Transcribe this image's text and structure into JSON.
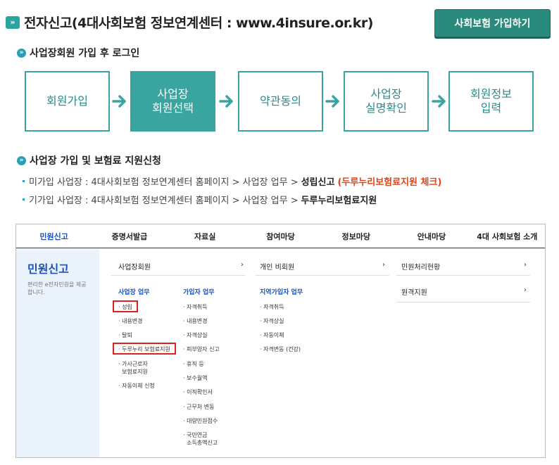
{
  "header": {
    "title_icon": "»",
    "title": "전자신고(4대사회보험 정보연계센터 : www.4insure.or.kr)",
    "join_button": "사회보험 가입하기"
  },
  "section1": {
    "icon": "»",
    "title": "사업장회원 가입 후 로그인",
    "steps": [
      "회원가입",
      "사업장\n회원선택",
      "약관동의",
      "사업장\n실명확인",
      "회원정보\n입력"
    ],
    "active_step_index": 1,
    "accent_color": "#3aa5a0"
  },
  "section2": {
    "icon": "»",
    "title": "사업장 가입 및 보험료 지원신청",
    "bullets": [
      {
        "prefix": "미가입 사업장 : 4대사회보험 정보연계센터 홈페이지 > 사업장 업무 >",
        "strong": "성립신고",
        "red": "(두루누리보험료지원 체크)"
      },
      {
        "prefix": "기가입 사업장 : 4대사회보험 정보연계센터 홈페이지 > 사업장 업무 >",
        "strong": "두루누리보험료지원",
        "red": ""
      }
    ]
  },
  "screenshot": {
    "nav": [
      "민원신고",
      "증명서발급",
      "자료실",
      "참여마당",
      "정보마당",
      "안내마당",
      "4대 사회보험 소개"
    ],
    "nav_active_index": 0,
    "left_title": "민원신고",
    "left_desc": "편리한 e전자민원을 제공합니다.",
    "columns": [
      {
        "head": "사업장회원",
        "chev": "›"
      },
      {
        "head": "개인 비회원",
        "chev": "›"
      },
      {
        "head": "민원처리현황",
        "chev": "›"
      }
    ],
    "extra_row": {
      "label": "원격지원",
      "chev": "›"
    },
    "groups": [
      {
        "title": "사업장 업무",
        "items": [
          "· 성립",
          "· 내용변경",
          "· 탈퇴",
          "· 두루누리 보험료지원",
          "· 가사근로자\n  보험료지원",
          "· 자동이체 신청"
        ]
      },
      {
        "title": "가입자 업무",
        "items": [
          "· 자격취득",
          "· 내용변경",
          "· 자격상실",
          "· 피부양자 신고",
          "· 휴직 등",
          "· 보수월액",
          "· 이직확인서",
          "· 근무처 변동",
          "· 대량민원접수",
          "· 국민연금\n  소득총액신고"
        ]
      },
      {
        "title": "지역가입자 업무",
        "items": [
          "· 자격취득",
          "· 자격상실",
          "· 자동이체",
          "· 자격변동 (건강)"
        ]
      }
    ],
    "highlight_color": "#e02020"
  }
}
